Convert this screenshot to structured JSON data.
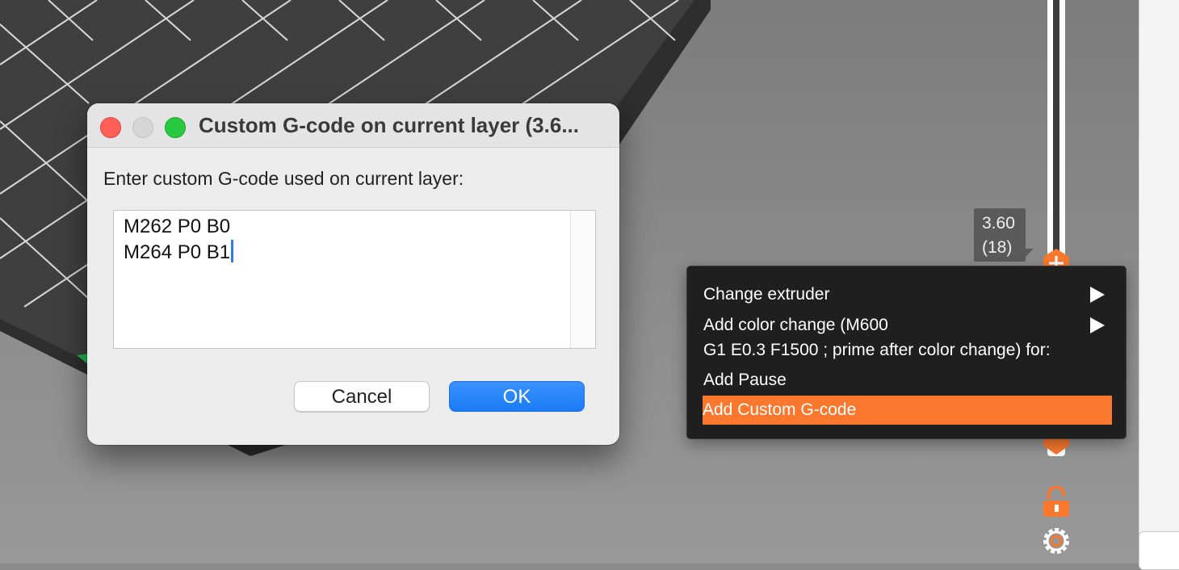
{
  "dialog": {
    "title": "Custom G-code on current layer (3.6...",
    "prompt": "Enter custom G-code used on current layer:",
    "gcode_line_1": "M262 P0 B0",
    "gcode_line_2": "M264 P0 B1",
    "cancel_label": "Cancel",
    "ok_label": "OK"
  },
  "layer_slider": {
    "height_label": "3.60",
    "layer_label": "(18)"
  },
  "context_menu": {
    "items": [
      {
        "label": "Change extruder",
        "submenu": true
      },
      {
        "label": "Add color change (M600",
        "submenu": true
      },
      {
        "label": "G1 E0.3 F1500 ; prime after color change) for:",
        "submenu": false
      },
      {
        "label": "Add Pause",
        "submenu": false
      },
      {
        "label": "Add Custom G-code",
        "submenu": false,
        "highlighted": true
      }
    ]
  },
  "colors": {
    "accent": "#fa782e",
    "ok_button": "#1a7bf5"
  },
  "icons": {
    "lock": "unlock-icon",
    "settings": "cog-icon",
    "thumb_upper": "plus-icon",
    "close": "close-icon"
  }
}
